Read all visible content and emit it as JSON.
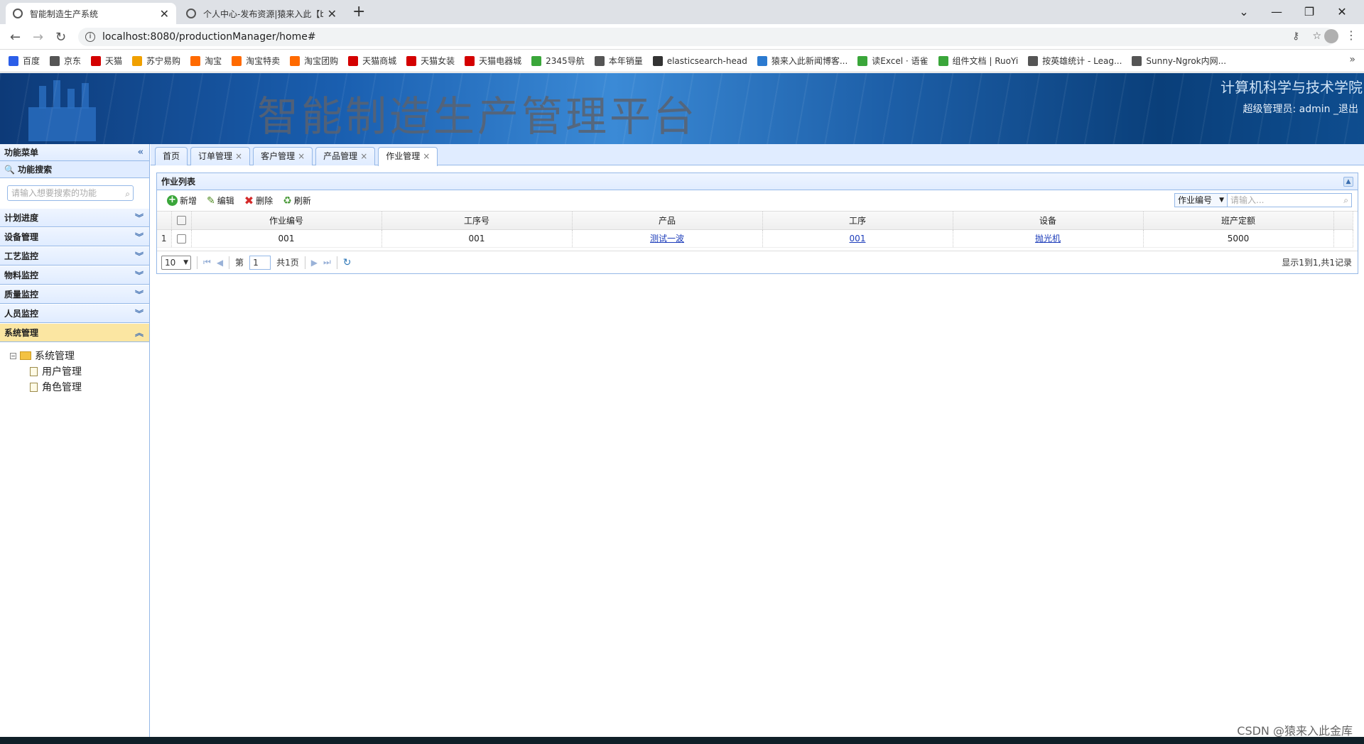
{
  "browser": {
    "tabs": [
      {
        "title": "智能制造生产系统",
        "active": true
      },
      {
        "title": "个人中心-发布资源|猿来入此【bi",
        "active": false
      }
    ],
    "url": "localhost:8080/productionManager/home#",
    "bookmarks": [
      {
        "label": "百度",
        "color": "#2b5ee8"
      },
      {
        "label": "京东",
        "color": "#555555"
      },
      {
        "label": "天猫",
        "color": "#d40000"
      },
      {
        "label": "苏宁易购",
        "color": "#f0a000"
      },
      {
        "label": "淘宝",
        "color": "#ff6a00"
      },
      {
        "label": "淘宝特卖",
        "color": "#ff6a00"
      },
      {
        "label": "淘宝团购",
        "color": "#ff6a00"
      },
      {
        "label": "天猫商城",
        "color": "#d40000"
      },
      {
        "label": "天猫女装",
        "color": "#d40000"
      },
      {
        "label": "天猫电器城",
        "color": "#d40000"
      },
      {
        "label": "2345导航",
        "color": "#3aa63a"
      },
      {
        "label": "本年销量",
        "color": "#555555"
      },
      {
        "label": "elasticsearch-head",
        "color": "#333333"
      },
      {
        "label": "猿来入此新闻博客...",
        "color": "#2b7ad0"
      },
      {
        "label": "读Excel · 语雀",
        "color": "#3aa63a"
      },
      {
        "label": "组件文档 | RuoYi",
        "color": "#3aa63a"
      },
      {
        "label": "按英雄统计 - Leag...",
        "color": "#555555"
      },
      {
        "label": "Sunny-Ngrok内网...",
        "color": "#555555"
      }
    ]
  },
  "header": {
    "title": "智能制造生产管理平台",
    "school": "计算机科学与技术学院",
    "user": "超级管理员: admin _退出"
  },
  "sidebar": {
    "title": "功能菜单",
    "search_title": "功能搜索",
    "search_placeholder": "请输入想要搜索的功能",
    "sections": [
      {
        "label": "计划进度",
        "selected": false
      },
      {
        "label": "设备管理",
        "selected": false
      },
      {
        "label": "工艺监控",
        "selected": false
      },
      {
        "label": "物料监控",
        "selected": false
      },
      {
        "label": "质量监控",
        "selected": false
      },
      {
        "label": "人员监控",
        "selected": false
      },
      {
        "label": "系统管理",
        "selected": true
      }
    ],
    "tree": {
      "root": "系统管理",
      "children": [
        "用户管理",
        "角色管理"
      ]
    }
  },
  "main": {
    "tabs": [
      "首页",
      "订单管理",
      "客户管理",
      "产品管理",
      "作业管理"
    ],
    "active_tab": "作业管理",
    "panel_title": "作业列表",
    "toolbar": {
      "add": "新增",
      "edit": "编辑",
      "delete": "删除",
      "refresh": "刷新"
    },
    "search": {
      "field": "作业编号",
      "placeholder": "请输入..."
    },
    "columns": [
      "作业编号",
      "工序号",
      "产品",
      "工序",
      "设备",
      "班产定额"
    ],
    "rows": [
      {
        "num": "1",
        "cells": [
          "001",
          "001",
          "测试一波",
          "001",
          "抛光机",
          "5000"
        ]
      }
    ],
    "pager": {
      "page_size": "10",
      "page_prefix": "第",
      "page": "1",
      "page_total": "共1页",
      "info": "显示1到1,共1记录"
    }
  },
  "watermark": "CSDN @猿来入此金库"
}
